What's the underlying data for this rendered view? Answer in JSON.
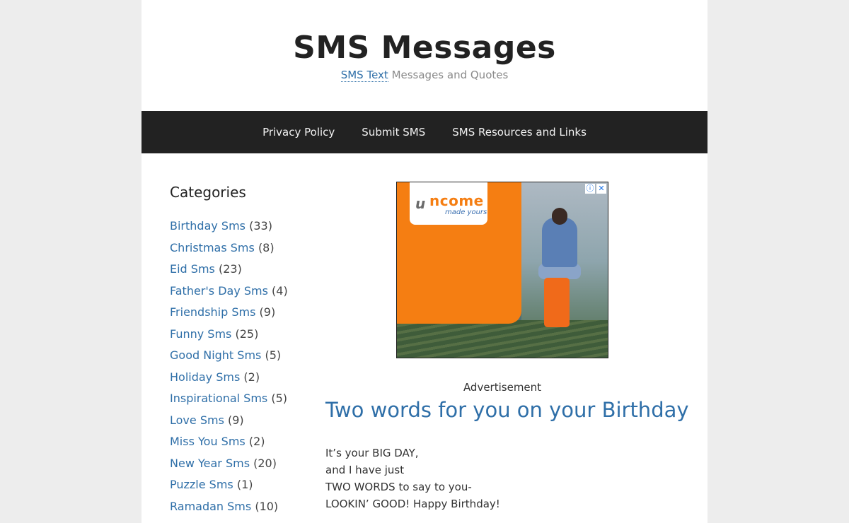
{
  "header": {
    "title": "SMS Messages",
    "tagline_link": "SMS Text",
    "tagline_rest": " Messages and Quotes"
  },
  "nav": {
    "items": [
      "Privacy Policy",
      "Submit SMS",
      "SMS Resources and Links"
    ]
  },
  "sidebar": {
    "heading": "Categories",
    "categories": [
      {
        "label": "Birthday Sms",
        "count": "(33)"
      },
      {
        "label": "Christmas Sms",
        "count": "(8)"
      },
      {
        "label": "Eid Sms",
        "count": "(23)"
      },
      {
        "label": "Father's Day Sms",
        "count": "(4)"
      },
      {
        "label": "Friendship Sms",
        "count": "(9)"
      },
      {
        "label": "Funny Sms",
        "count": "(25)"
      },
      {
        "label": "Good Night Sms",
        "count": "(5)"
      },
      {
        "label": "Holiday Sms",
        "count": "(2)"
      },
      {
        "label": "Inspirational Sms",
        "count": "(5)"
      },
      {
        "label": "Love Sms",
        "count": "(9)"
      },
      {
        "label": "Miss You Sms",
        "count": "(2)"
      },
      {
        "label": "New Year Sms",
        "count": "(20)"
      },
      {
        "label": "Puzzle Sms",
        "count": "(1)"
      },
      {
        "label": "Ramadan Sms",
        "count": "(10)"
      }
    ]
  },
  "ad": {
    "brand": "ncome",
    "brand_mark": "u",
    "slogan": "made yours",
    "info_glyph": "ⓘ",
    "close_glyph": "✕",
    "label": "Advertisement"
  },
  "post": {
    "title": "Two words for you on your Birthday",
    "lines": [
      "It’s your BIG DAY,",
      "and I have just",
      "TWO WORDS to say to you-",
      "LOOKIN’ GOOD! Happy Birthday!"
    ]
  },
  "colors": {
    "link": "#2f6fa8",
    "nav_bg": "#222222",
    "page_bg": "#ededed",
    "ad_orange": "#f57e12"
  }
}
